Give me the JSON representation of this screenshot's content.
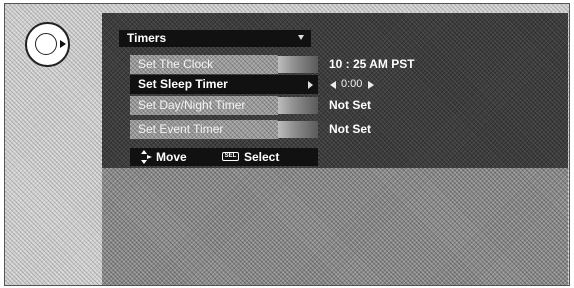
{
  "menu": {
    "title": "Timers",
    "items": [
      {
        "label": "Set The Clock",
        "value": "10 : 25 AM PST",
        "selected": false
      },
      {
        "label": "Set Sleep Timer",
        "value": "0:00",
        "selected": true
      },
      {
        "label": "Set Day/Night Timer",
        "value": "Not Set",
        "selected": false
      },
      {
        "label": "Set Event Timer",
        "value": "Not Set",
        "selected": false
      }
    ]
  },
  "help": {
    "move_label": "Move",
    "sel_key": "SEL",
    "select_label": "Select"
  },
  "icons": {
    "remote": "remote-right-button-icon",
    "move": "updown-right-arrows-icon",
    "left": "triangle-left-icon",
    "right": "triangle-right-icon",
    "dropdown": "caret-down-icon"
  }
}
